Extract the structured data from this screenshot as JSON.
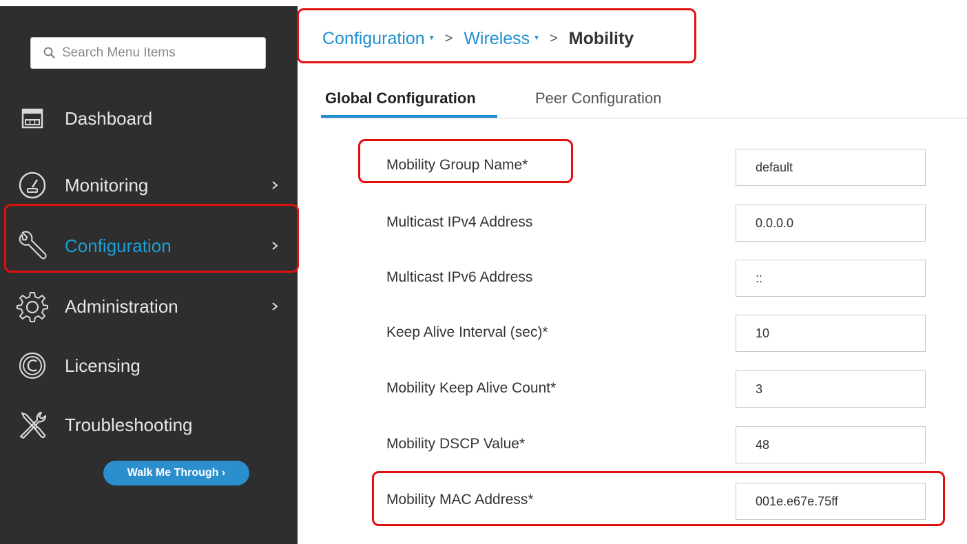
{
  "sidebar": {
    "search_placeholder": "Search Menu Items",
    "items": [
      {
        "label": "Dashboard",
        "icon": "dashboard-icon",
        "has_chevron": false
      },
      {
        "label": "Monitoring",
        "icon": "gauge-icon",
        "has_chevron": true
      },
      {
        "label": "Configuration",
        "icon": "wrench-icon",
        "has_chevron": true,
        "active": true
      },
      {
        "label": "Administration",
        "icon": "gear-icon",
        "has_chevron": true
      },
      {
        "label": "Licensing",
        "icon": "licensing-icon",
        "has_chevron": false
      },
      {
        "label": "Troubleshooting",
        "icon": "tools-icon",
        "has_chevron": false
      }
    ],
    "walk_me_through": "Walk Me Through ›"
  },
  "breadcrumb": {
    "items": [
      "Configuration",
      "Wireless",
      "Mobility"
    ]
  },
  "tabs": [
    "Global Configuration",
    "Peer Configuration"
  ],
  "form": {
    "fields": [
      {
        "label": "Mobility Group Name*",
        "value": "default"
      },
      {
        "label": "Multicast IPv4 Address",
        "value": "0.0.0.0"
      },
      {
        "label": "Multicast IPv6 Address",
        "value": "::"
      },
      {
        "label": "Keep Alive Interval (sec)*",
        "value": "10"
      },
      {
        "label": "Mobility Keep Alive Count*",
        "value": "3"
      },
      {
        "label": "Mobility DSCP Value*",
        "value": "48"
      },
      {
        "label": "Mobility MAC Address*",
        "value": "001e.e67e.75ff"
      }
    ]
  },
  "colors": {
    "sidebar_bg": "#2e2e2e",
    "accent": "#1f8fd0",
    "active_nav": "#1ba0d7",
    "highlight": "#e30e0e",
    "walk_button": "#2b8fce"
  }
}
